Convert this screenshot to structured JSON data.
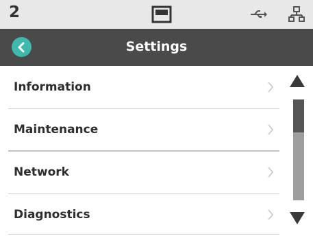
{
  "status": {
    "indicator_number": "2",
    "icons": [
      "battery-icon",
      "usb-icon",
      "network-icon"
    ]
  },
  "header": {
    "title": "Settings",
    "back_icon": "chevron-left-icon",
    "accent_color": "#3fb8ad"
  },
  "menu": {
    "items": [
      {
        "label": "Information"
      },
      {
        "label": "Maintenance"
      },
      {
        "label": "Network"
      },
      {
        "label": "Diagnostics"
      }
    ]
  },
  "scrollbar": {
    "up_icon": "triangle-up-icon",
    "down_icon": "triangle-down-icon",
    "position_fraction": 0.0
  }
}
